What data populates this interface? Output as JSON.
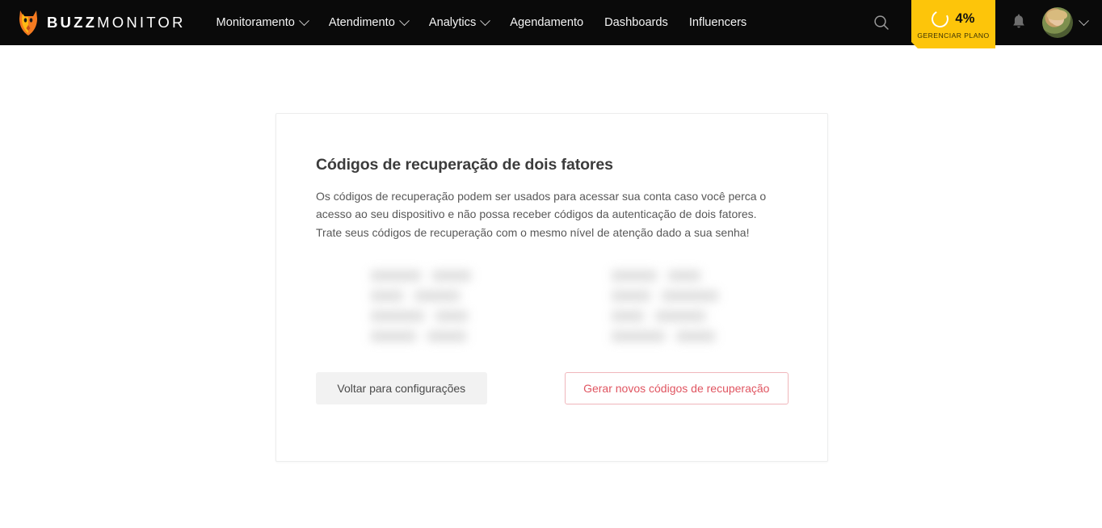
{
  "header": {
    "brand": {
      "bold": "BUZZ",
      "light": "MONITOR",
      "logo_icon": "fox-logo-icon"
    },
    "nav": [
      {
        "label": "Monitoramento",
        "has_dropdown": true
      },
      {
        "label": "Atendimento",
        "has_dropdown": true
      },
      {
        "label": "Analytics",
        "has_dropdown": true
      },
      {
        "label": "Agendamento",
        "has_dropdown": false
      },
      {
        "label": "Dashboards",
        "has_dropdown": false
      },
      {
        "label": "Influencers",
        "has_dropdown": false
      }
    ],
    "search_icon": "search-icon",
    "plan": {
      "percent": "4%",
      "label": "GERENCIAR PLANO",
      "progress_value": 4,
      "color": "#fdc50a"
    },
    "notifications_icon": "bell-icon",
    "avatar_icon": "user-avatar",
    "avatar_chevron_icon": "chevron-down-icon",
    "background_color": "#0a0a0a"
  },
  "main": {
    "card": {
      "title": "Códigos de recuperação de dois fatores",
      "description": "Os códigos de recuperação podem ser usados para acessar sua conta caso você perca o acesso ao seu dispositivo e não possa receber códigos da autenticação de dois fatores. Trate seus códigos de recuperação com o mesmo nível de atenção dado a sua senha!",
      "recovery_codes": {
        "obscured": true,
        "columns": 2,
        "rows_per_column": 4
      },
      "buttons": {
        "back": "Voltar para configurações",
        "generate": "Gerar novos códigos de recuperação",
        "generate_color": "#e05561"
      }
    }
  }
}
